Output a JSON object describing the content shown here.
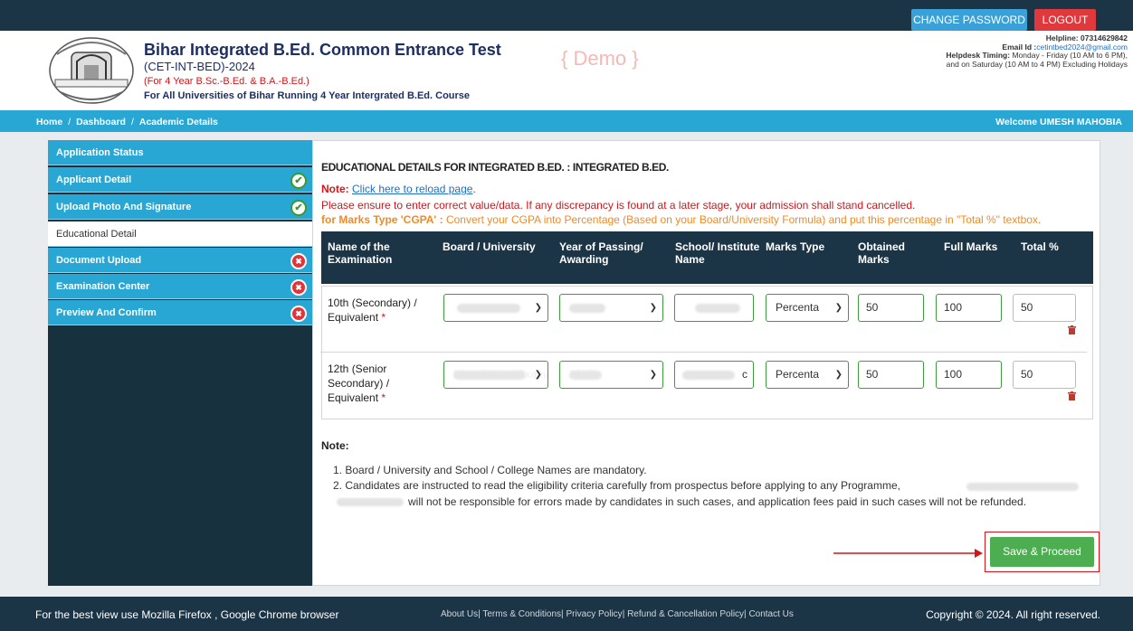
{
  "topbar": {
    "change_password": "CHANGE PASSWORD",
    "logout": "LOGOUT"
  },
  "header": {
    "title": "Bihar Integrated B.Ed. Common Entrance Test",
    "subtitle": "(CET-INT-BED)-2024",
    "course_line": "(For 4 Year B.Sc.-B.Ed. & B.A.-B.Ed.)",
    "universities_line": "For All Universities of Bihar Running 4 Year Intergrated B.Ed. Course",
    "demo_label": "{ Demo }",
    "helpline": "Helpline: 07314629842",
    "email_label": "Email Id :",
    "email": "cetintbed2024@gmail.com",
    "timing_label": "Helpdesk Timing:",
    "timing_1": "Monday - Friday (10 AM to 6 PM),",
    "timing_2": "and on Saturday (10 AM to 4 PM) Excluding Holidays"
  },
  "nav": {
    "breadcrumb": [
      "Home",
      "Dashboard",
      "Academic Details"
    ],
    "separator": "/",
    "welcome": "Welcome UMESH MAHOBIA"
  },
  "sidebar": {
    "items": [
      {
        "label": "Application Status",
        "status": "none"
      },
      {
        "label": "Applicant Detail",
        "status": "done"
      },
      {
        "label": "Upload Photo And Signature",
        "status": "done"
      },
      {
        "label": "Educational Detail",
        "status": "active"
      },
      {
        "label": "Document Upload",
        "status": "pending"
      },
      {
        "label": "Examination Center",
        "status": "pending"
      },
      {
        "label": "Preview And Confirm",
        "status": "pending"
      }
    ],
    "done_glyph": "✔",
    "pending_glyph": "✖"
  },
  "main": {
    "title": "EDUCATIONAL DETAILS FOR INTEGRATED B.ED. : INTEGRATED B.ED.",
    "note_prefix": "Note: ",
    "reload_link": "Click here to reload page",
    "reload_suffix": ".",
    "warning": "Please ensure to enter correct value/data. If any discrepancy is found at a later stage, your admission shall stand cancelled.",
    "cgpa_prefix": "for Marks Type 'CGPA' :",
    "cgpa_text": " Convert your CGPA into Percentage (Based on your Board/University Formula) and put this percentage in \"Total %\" textbox.",
    "table": {
      "headers": {
        "exam_1": "Name of the",
        "exam_2": "Examination",
        "board": "Board / University",
        "year_1": "Year of Passing/",
        "year_2": "Awarding",
        "school_1": "School/ Institute",
        "school_2": "Name",
        "marks_type": "Marks Type",
        "obtained_1": "Obtained",
        "obtained_2": "Marks",
        "full": "Full Marks",
        "total": "Total %"
      },
      "rows": [
        {
          "exam_1": "10th (Secondary) /",
          "exam_2": "Equivalent",
          "exam_3": "",
          "required": "*",
          "board": "",
          "year": "",
          "school": "",
          "marks_type": "Percenta",
          "obtained": "50",
          "full": "100",
          "total": "50"
        },
        {
          "exam_1": "12th (Senior",
          "exam_2": "Secondary) /",
          "exam_3": "Equivalent",
          "required": "*",
          "board": "Bihar School Examination Board",
          "year": "2017",
          "school": "c",
          "marks_type": "Percenta",
          "obtained": "50",
          "full": "100",
          "total": "50"
        }
      ]
    },
    "note_heading": "Note:",
    "notes": [
      "1. Board / University and School / College Names are mandatory.",
      "2. Candidates are instructed to read the eligibility criteria carefully from prospectus before applying to any Programme,",
      "will not be responsible for errors made by candidates in such cases, and application fees paid in such cases will not be refunded."
    ],
    "save_button": "Save & Proceed"
  },
  "footer": {
    "browser_note": "For the best view use Mozilla Firefox , Google Chrome browser",
    "links": [
      "About Us",
      "Terms & Conditions",
      "Privacy Policy",
      "Refund & Cancellation Policy",
      "Contact Us"
    ],
    "copyright": "Copyright © 2024. All right reserved."
  },
  "colors": {
    "topbar": "#1c3546",
    "nav": "#29a7d4",
    "accent_red": "#d0161b",
    "save_green": "#4dae51"
  }
}
